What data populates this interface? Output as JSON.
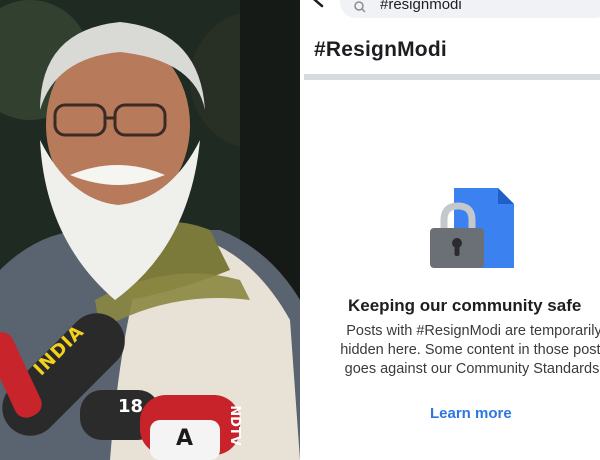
{
  "photo": {
    "mic_labels": [
      "INDIA",
      "18",
      "NDTV",
      "A"
    ]
  },
  "search": {
    "query": "#resignmodi"
  },
  "hashtag": {
    "title": "#ResignModi"
  },
  "notice": {
    "title": "Keeping our community safe",
    "body_lines": [
      "Posts with #ResignModi are temporarily",
      "hidden here. Some content in those posts",
      "goes against our Community Standards."
    ],
    "learn_more_label": "Learn more"
  },
  "colors": {
    "link_blue": "#2d77e0",
    "document_blue": "#3b82f0",
    "lock_gray": "#6b6f76"
  },
  "icons": {
    "back": "chevron-left-icon",
    "search": "search-icon",
    "lock": "lock-icon",
    "document": "document-icon"
  }
}
